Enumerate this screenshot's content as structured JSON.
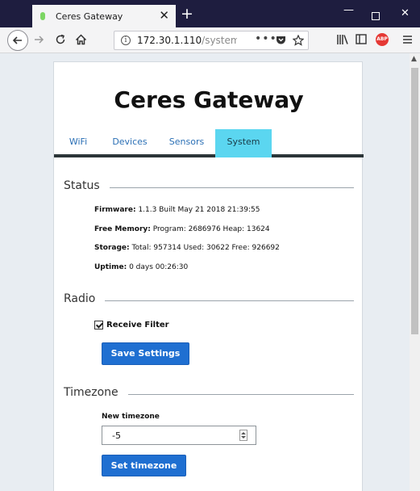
{
  "browser": {
    "tab_title": "Ceres Gateway",
    "tab_close": "✕",
    "new_tab": "+",
    "window_minimize": "—",
    "window_close": "✕",
    "url_host": "172.30.1.110",
    "url_path": "/system.htm",
    "url_more": "•••"
  },
  "page": {
    "brand": "Ceres Gateway",
    "tabs": [
      {
        "label": "WiFi",
        "active": false
      },
      {
        "label": "Devices",
        "active": false
      },
      {
        "label": "Sensors",
        "active": false
      },
      {
        "label": "System",
        "active": true
      }
    ],
    "status": {
      "title": "Status",
      "firmware_label": "Firmware:",
      "firmware_value": " 1.1.3 Built May 21 2018 21:39:55",
      "memory_label": "Free Memory:",
      "memory_value": " Program: 2686976 Heap: 13624",
      "storage_label": "Storage:",
      "storage_value": " Total: 957314 Used: 30622 Free: 926692",
      "uptime_label": "Uptime:",
      "uptime_value": " 0 days 00:26:30"
    },
    "radio": {
      "title": "Radio",
      "receive_filter_label": "Receive Filter",
      "receive_filter_checked": true,
      "save_button": "Save Settings"
    },
    "timezone": {
      "title": "Timezone",
      "field_label": "New timezone",
      "value": "-5",
      "set_button": "Set timezone"
    }
  },
  "colors": {
    "tab_active": "#5bd6f0",
    "button": "#1f6fd1",
    "tab_link": "#2a6fb5",
    "titlebar": "#1e1d3f"
  }
}
